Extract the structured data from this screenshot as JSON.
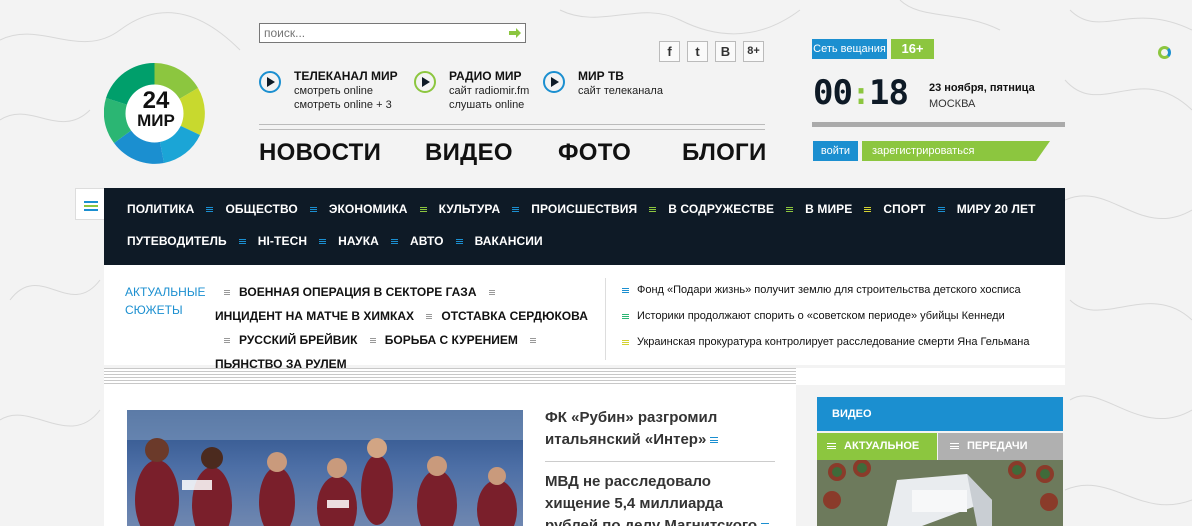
{
  "search": {
    "placeholder": "поиск..."
  },
  "logo": {
    "line1": "24",
    "line2": "МИР"
  },
  "channels": [
    {
      "title": "ТЕЛЕКАНАЛ МИР",
      "sub1": "смотреть online",
      "sub2": "смотреть online + 3"
    },
    {
      "title": "РАДИО МИР",
      "sub1": "сайт radiomir.fm",
      "sub2": "слушать online"
    },
    {
      "title": "МИР ТВ",
      "sub1": "сайт телеканала",
      "sub2": ""
    }
  ],
  "social": [
    "f",
    "t",
    "B",
    "8+"
  ],
  "main_nav": [
    "НОВОСТИ",
    "ВИДЕО",
    "ФОТО",
    "БЛОГИ"
  ],
  "header_right": {
    "broadcast": "Сеть вещания",
    "age": "16+",
    "clock_h": "00",
    "clock_sep": ":",
    "clock_m": "18",
    "date": "23 ноября, пятница",
    "city": "МОСКВА",
    "login": "войти",
    "register": "зарегистрироваться"
  },
  "menu_row1": [
    "ПОЛИТИКА",
    "ОБЩЕСТВО",
    "ЭКОНОМИКА",
    "КУЛЬТУРА",
    "ПРОИСШЕСТВИЯ",
    "В СОДРУЖЕСТВЕ",
    "В МИРЕ",
    "СПОРТ",
    "МИРУ 20 ЛЕТ"
  ],
  "menu_row2": [
    "ПУТЕВОДИТЕЛЬ",
    "HI-TECH",
    "НАУКА",
    "АВТО",
    "ВАКАНСИИ"
  ],
  "colors": {
    "blue": "#1b8fd0",
    "green": "#8cc63f",
    "dark": "#0e1a26",
    "yellow": "#d4d232"
  },
  "aktual_label": "АКТУАЛЬНЫЕ СЮЖЕТЫ",
  "topics": [
    "ВОЕННАЯ ОПЕРАЦИЯ В СЕКТОРЕ ГАЗА",
    "ИНЦИДЕНТ НА МАТЧЕ В ХИМКАХ",
    "ОТСТАВКА СЕРДЮКОВА",
    "РУССКИЙ БРЕЙВИК",
    "БОРЬБА С КУРЕНИЕМ",
    "ПЬЯНСТВО ЗА РУЛЕМ"
  ],
  "side_news": [
    "Фонд «Подари жизнь» получит землю для строительства детского хосписа",
    "Историки продолжают спорить о «советском периоде» убийцы Кеннеди",
    "Украинская прокуратура контролирует расследование смерти Яна Гельмана"
  ],
  "headlines": [
    "ФК «Рубин» разгромил итальянский «Интер»",
    "МВД не расследовало хищение 5,4 миллиарда рублей по делу Магнитского"
  ],
  "video": {
    "title": "ВИДЕО",
    "tab1": "АКТУАЛЬНОЕ",
    "tab2": "ПЕРЕДАЧИ"
  }
}
